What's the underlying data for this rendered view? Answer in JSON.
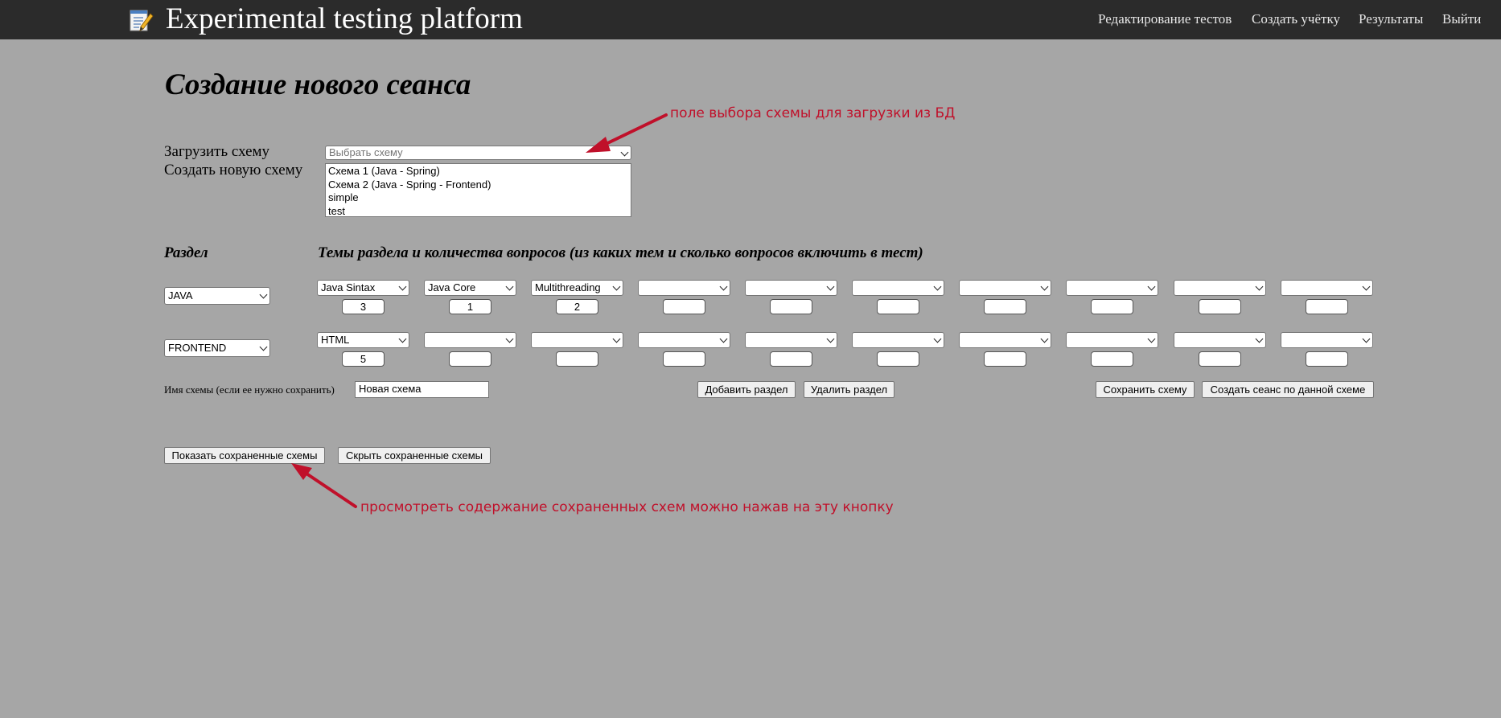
{
  "header": {
    "brand_title": "Experimental testing platform",
    "brand_icon": "notepad-pencil-icon",
    "nav": [
      {
        "label": "Редактирование тестов"
      },
      {
        "label": "Создать учётку"
      },
      {
        "label": "Результаты"
      },
      {
        "label": "Выйти"
      }
    ]
  },
  "page": {
    "title": "Создание нового сеанса",
    "load_scheme_label": "Загрузить схему",
    "create_scheme_label": "Создать новую схему",
    "scheme_select_placeholder": "Выбрать схему",
    "scheme_options": [
      "Схема 1 (Java - Spring)",
      "Схема 2 (Java - Spring - Frontend)",
      "simple",
      "test"
    ]
  },
  "grid": {
    "section_header": "Раздел",
    "topics_header": "Темы раздела и количества вопросов (из каких тем и сколько вопросов включить в тест)",
    "rows": [
      {
        "section": "JAVA",
        "topics": [
          "Java Sintax",
          "Java Core",
          "Multithreading",
          "",
          "",
          "",
          "",
          "",
          "",
          ""
        ],
        "counts": [
          "3",
          "1",
          "2",
          "",
          "",
          "",
          "",
          "",
          "",
          ""
        ]
      },
      {
        "section": "FRONTEND",
        "topics": [
          "HTML",
          "",
          "",
          "",
          "",
          "",
          "",
          "",
          "",
          ""
        ],
        "counts": [
          "5",
          "",
          "",
          "",
          "",
          "",
          "",
          "",
          "",
          ""
        ]
      }
    ]
  },
  "scheme_name": {
    "label": "Имя схемы (если ее нужно сохранить)",
    "value": "Новая схема"
  },
  "buttons": {
    "add_section": "Добавить раздел",
    "remove_section": "Удалить раздел",
    "save_scheme": "Сохранить схему",
    "create_session": "Создать сеанс по данной схеме",
    "show_saved": "Показать сохраненные схемы",
    "hide_saved": "Скрыть сохраненные схемы"
  },
  "annotations": {
    "select_note": "поле выбора схемы для загрузки из БД",
    "button_note": "просмотреть содержание сохраненных схем можно нажав на эту кнопку",
    "color": "#c0102a"
  },
  "colors": {
    "background": "#a6a6a6",
    "topbar": "#2b2b2b"
  }
}
